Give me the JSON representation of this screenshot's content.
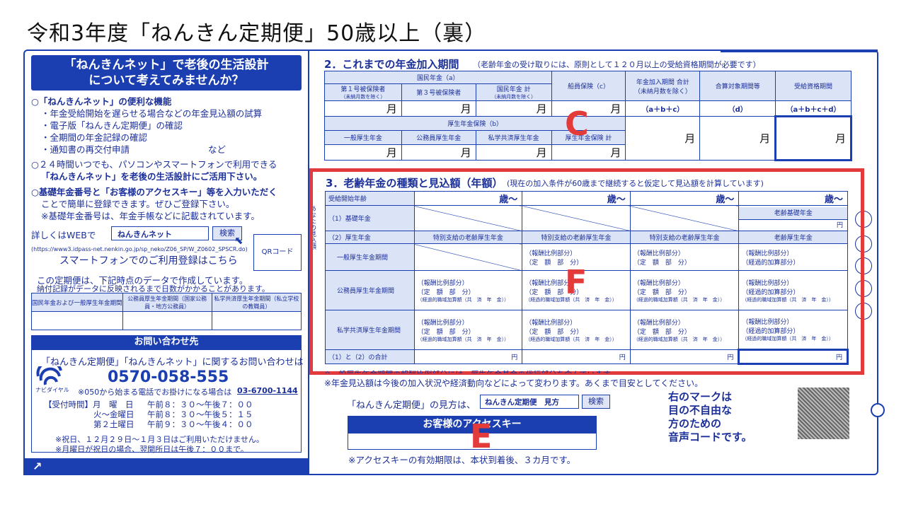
{
  "title": "令和3年度「ねんきん定期便」50歳以上（裏）",
  "left": {
    "headline_1": "「ねんきんネット」で老後の生活設計",
    "headline_2": "について考えてみませんか？",
    "features_title": "○「ねんきんネット」の便利な機能",
    "features": [
      "・年金受給開始を遅らせる場合などの年金見込額の試算",
      "・電子版「ねんきん定期便」の確認",
      "・全期間の年金記録の確認",
      "・通知書の再交付申請"
    ],
    "features_etc": "など",
    "p1_line1": "○２４時間いつでも、パソコンやスマートフォンで利用できる",
    "p1_line2": "「ねんきんネット」を老後の生活設計にご活用下さい。",
    "p2_line1": "○基礎年金番号と「お客様のアクセスキー」等を入力いただく",
    "p2_line2": "ことで簡単に登録できます。ぜひご登録下さい。",
    "p2_line3": "※基礎年金番号は、年金手帳などに記載されています。",
    "web_label": "詳しくはWEBで",
    "search_value": "ねんきんネット",
    "search_button": "検索",
    "url": "(https://www3.idpass-net.nenkin.go.jp/sp_neko/Z06_SP/W_Z0602_SPSCR.do)",
    "smartphone": "スマートフォンでのご利用登録はこちら",
    "qr_label": "QRコード",
    "data_note1": "この定期便は、下記時点のデータで作成しています。",
    "data_note2": "納付記録がデータに反映されるまで日数がかかることがあります。",
    "date_cols": [
      "国民年金および一般厚生年金期間",
      "公務員厚生年金期間（国家公務員・地方公務員）",
      "私学共済厚生年金期間（私立学校の教職員）"
    ],
    "contact_title": "お問い合わせ先",
    "contact_line": "「ねんきん定期便」「ねんきんネット」に関するお問い合わせは",
    "phone": "0570-058-555",
    "navi_label": "ナビダイヤル",
    "alt_phone_note": "※050から始まる電話でお掛けになる場合は",
    "alt_phone": "03-6700-1144",
    "hours": [
      {
        "label": "【受付時間】月　曜　日",
        "time": "午前８：３０〜午後７：００"
      },
      {
        "label": "火〜金曜日",
        "time": "午前８：３０〜午後５：１５"
      },
      {
        "label": "第２土曜日",
        "time": "午前９：３０〜午後４：００"
      }
    ],
    "holiday_note1": "※祝日、１２月２９日〜１月３日はご利用いただけません。",
    "holiday_note2": "※月曜日が祝日の場合、翌開所日は午後７：００まで。",
    "arrow": "↗"
  },
  "sec2": {
    "title": "2．これまでの年金加入期間",
    "subtitle": "（老齢年金の受け取りには、原則として１２０月以上の受給資格期間が必要です）",
    "kokumin": "国民年金（a）",
    "col1": "第１号被保険者",
    "col1b": "（未納月数を除く）",
    "col2": "第３号被保険者",
    "col3": "国民年金 計",
    "col3b": "（未納月数を除く）",
    "senin": "船員保険（c）",
    "total": "年金加入期間 合計",
    "total_b": "（未納月数を除く）",
    "total_formula": "（a＋b＋c）",
    "gassan": "合算対象期間等",
    "gassan_d": "（d）",
    "jukyu": "受給資格期間",
    "jukyu_formula": "（a＋b＋c＋d）",
    "kosei": "厚生年金保険（b）",
    "k1": "一般厚生年金",
    "k2": "公務員厚生年金",
    "k3": "私学共済厚生年金",
    "k4": "厚生年金保険 計",
    "month": "月"
  },
  "sec3": {
    "title": "3．老齢年金の種類と見込額（年額）",
    "subtitle": "(現在の加入条件が60歳まで継続すると仮定して見込額を計算しています)",
    "start_age": "受給開始年齢",
    "age_suffix": "歳〜",
    "row1": "（1）基礎年金",
    "row2": "（2）厚生年金",
    "basic_pension": "老齢基礎年金",
    "special": "特別支給の老齢厚生年金",
    "old_age": "老齢厚生年金",
    "sub_general": "一般厚生年金期間",
    "sub_public": "公務員厚生年金期間",
    "sub_private": "私学共済厚生年金期間",
    "hoshu": "（報酬比例部分）",
    "teigaku": "（定　額　部　分）",
    "keika": "（経過的加算部分）",
    "shokuiki": "（経過的職域加算額（共　済　年　金））",
    "sum": "（1）と（2）の合計",
    "yen": "円",
    "side_label": "あなたの見込額"
  },
  "notes": {
    "hidden_note": "※一般厚生年金期間の報酬比例部分には、厚生年金基金の代行部分を含んでいます。",
    "note1": "※年金見込額は今後の加入状況や経済動向などによって変わります。あくまで目安としてください。",
    "viewer_label": "「ねんきん定期便」の見方は、",
    "viewer_search": "ねんきん定期便　見方",
    "viewer_button": "検索",
    "access_key": "お客様のアクセスキー",
    "access_note": "※アクセスキーの有効期限は、本状到着後、３カ月です。",
    "voice1": "右のマークは",
    "voice2": "目の不自由な",
    "voice3": "方のための",
    "voice4": "音声コードです。"
  },
  "annotations": {
    "c": "C",
    "f": "F",
    "e": "E"
  }
}
